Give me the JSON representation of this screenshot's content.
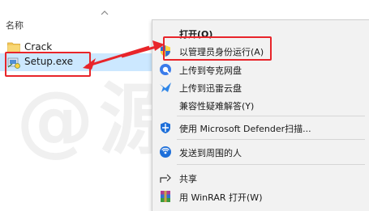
{
  "explorer": {
    "column_header": "名称",
    "files": [
      {
        "name": "Crack",
        "icon": "folder-icon"
      },
      {
        "name": "Setup.exe",
        "icon": "installer-icon",
        "selected": true
      }
    ]
  },
  "context_menu": {
    "items": [
      {
        "label": "打开(O)",
        "icon": "",
        "bold": true
      },
      {
        "label": "以管理员身份运行(A)",
        "icon": "uac-shield-icon"
      },
      {
        "label": "上传到夸克网盘",
        "icon": "quark-cloud-icon"
      },
      {
        "label": "上传到迅雷云盘",
        "icon": "xunlei-bird-icon"
      },
      {
        "label": "兼容性疑难解答(Y)",
        "icon": ""
      },
      {
        "label": "使用 Microsoft Defender扫描...",
        "icon": "defender-shield-icon"
      },
      {
        "label": "发送到周围的人",
        "icon": "nearby-share-icon"
      },
      {
        "label": "共享",
        "icon": "share-icon"
      },
      {
        "label": "用 WinRAR 打开(W)",
        "icon": "winrar-icon"
      }
    ]
  },
  "watermark": "@源工风",
  "colors": {
    "selection": "#cce8ff",
    "menu_background": "#f2f2f2",
    "annotation": "#e8252a",
    "defender_blue": "#1e6fd9"
  }
}
